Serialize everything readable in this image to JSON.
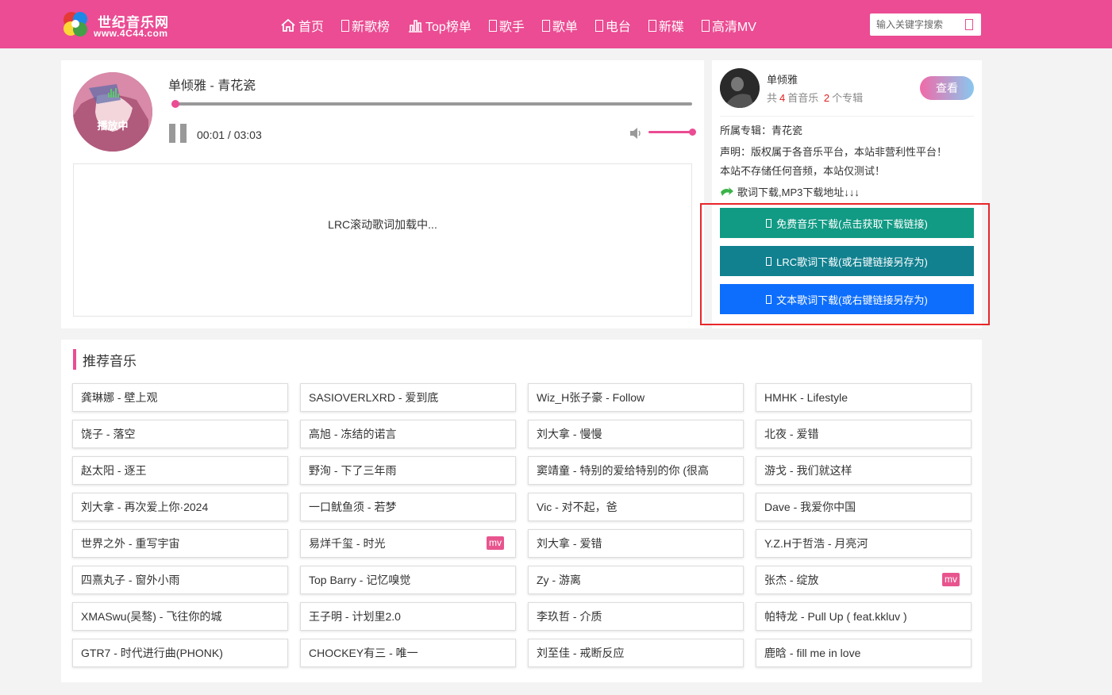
{
  "header": {
    "logo_title": "世纪音乐网",
    "logo_sub": "www.4C44.com",
    "nav": [
      {
        "label": "首页",
        "icon": "home-icon"
      },
      {
        "label": "新歌榜",
        "icon": "box-icon"
      },
      {
        "label": "Top榜单",
        "icon": "bar-chart-icon"
      },
      {
        "label": "歌手",
        "icon": "box-icon"
      },
      {
        "label": "歌单",
        "icon": "box-icon"
      },
      {
        "label": "电台",
        "icon": "box-icon"
      },
      {
        "label": "新碟",
        "icon": "box-icon"
      },
      {
        "label": "高清MV",
        "icon": "box-icon"
      }
    ],
    "search_placeholder": "输入关键字搜索"
  },
  "player": {
    "cover_status": "播放中",
    "song_title": "单倾雅 - 青花瓷",
    "current_time": "00:01",
    "total_time": "03:03",
    "time_text": "00:01 / 03:03",
    "progress_fraction": 0.0055,
    "volume_fraction": 1.0,
    "lyrics_placeholder": "LRC滚动歌词加载中..."
  },
  "artist": {
    "name": "单倾雅",
    "stats_prefix": "共",
    "song_count": "4",
    "song_unit": "首音乐",
    "album_count": "2",
    "album_unit": "个专辑",
    "view_label": "查看",
    "album_line": "所属专辑：青花瓷",
    "notice_line1": "声明：版权属于各音乐平台，本站非营利性平台！",
    "notice_line2": "本站不存储任何音频，本站仅测试！",
    "download_hint": "歌词下载,MP3下载地址↓↓↓",
    "downloads": [
      {
        "label": "免费音乐下载(点击获取下载链接)",
        "color": "#119a84"
      },
      {
        "label": "LRC歌词下载(或右键链接另存为)",
        "color": "#11808f"
      },
      {
        "label": "文本歌词下载(或右键链接另存为)",
        "color": "#0d6efd"
      }
    ],
    "highlight_color": "#e8262a"
  },
  "recommend": {
    "title": "推荐音乐",
    "items": [
      {
        "label": "龚琳娜 - 壁上观",
        "mv": false
      },
      {
        "label": "SASIOVERLXRD - 爱到底",
        "mv": false
      },
      {
        "label": "Wiz_H张子豪 - Follow",
        "mv": false
      },
      {
        "label": "HMHK - Lifestyle",
        "mv": false
      },
      {
        "label": "饶子 - 落空",
        "mv": false
      },
      {
        "label": "高旭 - 冻结的诺言",
        "mv": false
      },
      {
        "label": "刘大拿 - 慢慢",
        "mv": false
      },
      {
        "label": "北夜 - 爱错",
        "mv": false
      },
      {
        "label": "赵太阳 - 逐王",
        "mv": false
      },
      {
        "label": "野洵 - 下了三年雨",
        "mv": false
      },
      {
        "label": "窦靖童 - 特别的爱给特别的你 (很高",
        "mv": false
      },
      {
        "label": "游戈 - 我们就这样",
        "mv": false
      },
      {
        "label": "刘大拿 - 再次爱上你·2024",
        "mv": false
      },
      {
        "label": "一口鱿鱼须 - 若梦",
        "mv": false
      },
      {
        "label": "Vic - 对不起，爸",
        "mv": false
      },
      {
        "label": "Dave - 我爱你中国",
        "mv": false
      },
      {
        "label": "世界之外 - 重写宇宙",
        "mv": false
      },
      {
        "label": "易烊千玺 - 时光",
        "mv": true
      },
      {
        "label": "刘大拿 - 爱错",
        "mv": false
      },
      {
        "label": "Y.Z.H于哲浩 - 月亮河",
        "mv": false
      },
      {
        "label": "四熹丸子 - 窗外小雨",
        "mv": false
      },
      {
        "label": "Top Barry - 记忆嗅觉",
        "mv": false
      },
      {
        "label": "Zy - 游离",
        "mv": false
      },
      {
        "label": "张杰 - 绽放",
        "mv": true
      },
      {
        "label": "XMASwu(吴骜) - 飞往你的城",
        "mv": false
      },
      {
        "label": "王子明 - 计划里2.0",
        "mv": false
      },
      {
        "label": "李玖哲 - 介质",
        "mv": false
      },
      {
        "label": "帕特龙 - Pull Up ( feat.kkluv )",
        "mv": false
      },
      {
        "label": "GTR7 - 时代进行曲(PHONK)",
        "mv": false
      },
      {
        "label": "CHOCKEY有三 - 唯一",
        "mv": false
      },
      {
        "label": "刘至佳 - 戒断反应",
        "mv": false
      },
      {
        "label": "鹿晗 - fill me in love",
        "mv": false
      }
    ],
    "mv_label": "mv"
  }
}
